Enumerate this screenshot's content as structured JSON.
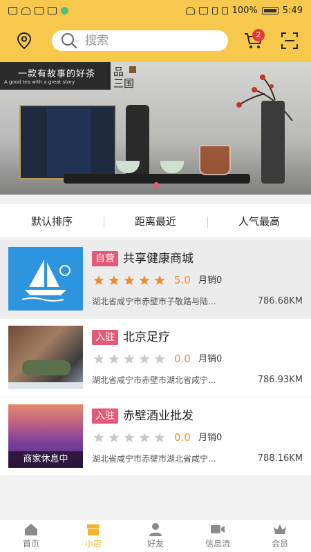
{
  "status": {
    "battery": "100%",
    "time": "5:49"
  },
  "search": {
    "placeholder": "搜索"
  },
  "cart": {
    "badge": "2"
  },
  "banner": {
    "slogan": "一款有故事的好茶",
    "slogan_en": "A good tea with a great story",
    "brand_line1": "品",
    "brand_line2": "三国"
  },
  "sort": {
    "items": [
      "默认排序",
      "距离最近",
      "人气最高"
    ],
    "active_index": 0
  },
  "shops": [
    {
      "tag": "自营",
      "name": "共享健康商城",
      "rating": "5.0",
      "stars_filled": 5,
      "sales": "月销0",
      "address": "湖北省咸宁市赤壁市子敬路与陆...",
      "distance": "786.68KM",
      "closed_label": ""
    },
    {
      "tag": "入驻",
      "name": "北京足疗",
      "rating": "0.0",
      "stars_filled": 0,
      "sales": "月销0",
      "address": "湖北省咸宁市赤壁市湖北省咸宁...",
      "distance": "786.93KM",
      "closed_label": ""
    },
    {
      "tag": "入驻",
      "name": "赤壁酒业批发",
      "rating": "0.0",
      "stars_filled": 0,
      "sales": "月销0",
      "address": "湖北省咸宁市赤壁市湖北省咸宁...",
      "distance": "788.16KM",
      "closed_label": "商家休息中"
    }
  ],
  "tabbar": {
    "items": [
      "首页",
      "小店",
      "好友",
      "信息流",
      "会员"
    ],
    "active_index": 1
  },
  "colors": {
    "accent": "#f6c84b",
    "tag": "#e35a77",
    "star_on": "#f08d2a",
    "star_off": "#c8c8c8"
  },
  "icons": {
    "location": "location-pin-icon",
    "search": "search-icon",
    "cart": "cart-icon",
    "scan": "scan-icon"
  }
}
